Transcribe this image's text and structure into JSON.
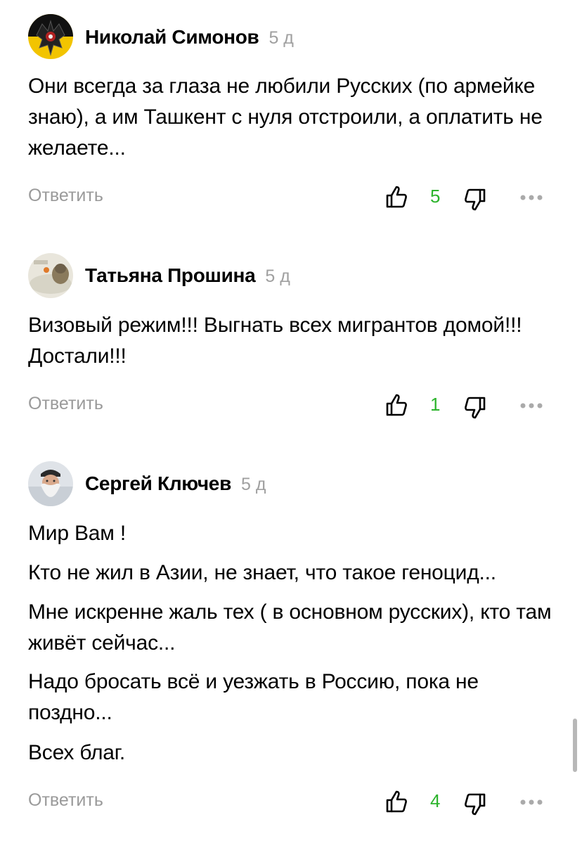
{
  "comments": [
    {
      "author": "Николай Симонов",
      "time": "5 д",
      "paragraphs": [
        "Они всегда за глаза не любили Русских (по армейке знаю), а им Ташкент с нуля отстроили, а оплатить не желаете..."
      ],
      "reply_label": "Ответить",
      "likes": "5"
    },
    {
      "author": "Татьяна Прошина",
      "time": "5 д",
      "paragraphs": [
        "Визовый режим!!! Выгнать всех мигрантов домой!!! Достали!!!"
      ],
      "reply_label": "Ответить",
      "likes": "1"
    },
    {
      "author": "Сергей Ключев",
      "time": "5 д",
      "paragraphs": [
        "Мир Вам !",
        "Кто не жил в Азии, не знает, что такое геноцид...",
        "Мне искренне жаль тех ( в основном русских), кто там живёт сейчас...",
        "Надо бросать всё и уезжать в Россию, пока не поздно...",
        "Всех благ."
      ],
      "reply_label": "Ответить",
      "likes": "4"
    }
  ],
  "colors": {
    "likes_count": "#2db42d",
    "secondary_text": "#9a9a9a",
    "icon_stroke": "#000000"
  },
  "icons": {
    "like": "thumbs-up-icon",
    "dislike": "thumbs-down-icon",
    "more": "more-dots-icon"
  }
}
